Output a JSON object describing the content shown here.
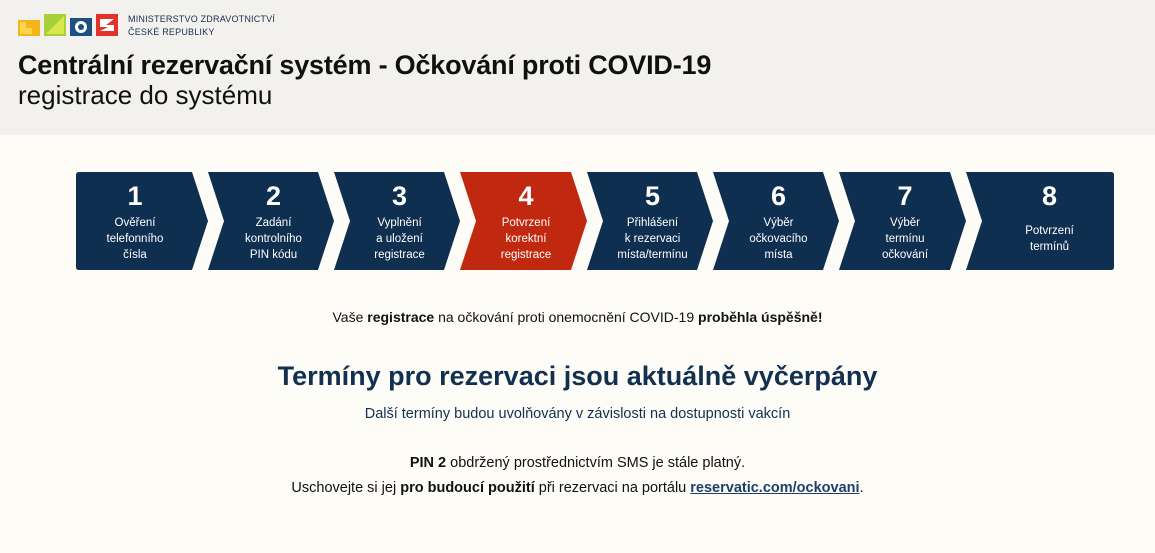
{
  "header": {
    "ministry_line1": "MINISTERSTVO ZDRAVOTNICTVÍ",
    "ministry_line2": "ČESKÉ REPUBLIKY",
    "title": "Centrální rezervační systém - Očkování proti COVID-19",
    "subtitle": "registrace do systému"
  },
  "colors": {
    "step_default": "#0e2f4f",
    "step_active": "#c0280f",
    "headline": "#12304f",
    "header_bg": "#f2f1ed",
    "page_bg": "#fdfcf7"
  },
  "steps": [
    {
      "num": "1",
      "lines": [
        "Ověření",
        "telefonního",
        "čísla"
      ],
      "active": false
    },
    {
      "num": "2",
      "lines": [
        "Zadání",
        "kontrolního",
        "PIN kódu"
      ],
      "active": false
    },
    {
      "num": "3",
      "lines": [
        "Vyplnění",
        "a uložení",
        "registrace"
      ],
      "active": false
    },
    {
      "num": "4",
      "lines": [
        "Potvrzení",
        "korektní",
        "registrace"
      ],
      "active": true
    },
    {
      "num": "5",
      "lines": [
        "Přihlášení",
        "k rezervaci",
        "místa/termínu"
      ],
      "active": false
    },
    {
      "num": "6",
      "lines": [
        "Výběr",
        "očkovacího",
        "místa"
      ],
      "active": false
    },
    {
      "num": "7",
      "lines": [
        "Výběr",
        "termínu",
        "očkování"
      ],
      "active": false
    },
    {
      "num": "8",
      "lines": [
        "Potvrzení",
        "termínů"
      ],
      "active": false
    }
  ],
  "message": {
    "p1": "Vaše ",
    "b1": "registrace",
    "p2": " na očkování proti onemocnění COVID-19 ",
    "b2": "proběhla úspěšně!"
  },
  "headline": "Termíny pro rezervaci jsou aktuálně vyčerpány",
  "subline": "Další termíny budou uvolňovány v závislosti na dostupnosti vakcín",
  "pin": {
    "b1": "PIN 2",
    "p1": " obdržený prostřednictvím SMS je stále platný.",
    "p2": "Uschovejte si jej ",
    "b2": "pro budoucí použití",
    "p3": " při rezervaci na portálu ",
    "link": "reservatic.com/ockovani",
    "p4": "."
  }
}
